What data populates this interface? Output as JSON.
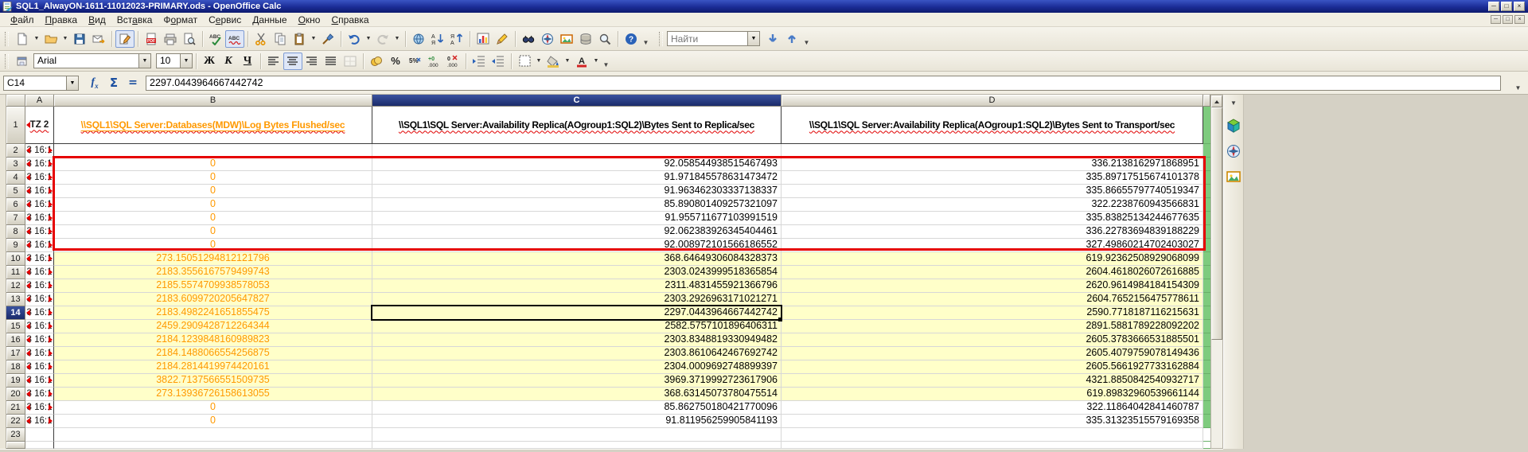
{
  "window": {
    "title": "SQL1_AlwayON-1611-11012023-PRIMARY.ods - OpenOffice Calc",
    "controls": {
      "minimize": "─",
      "maximize": "□",
      "close": "×"
    }
  },
  "menu": {
    "items": [
      {
        "label": "Файл",
        "accel": 0
      },
      {
        "label": "Правка",
        "accel": 0
      },
      {
        "label": "Вид",
        "accel": 0
      },
      {
        "label": "Вставка",
        "accel": 3
      },
      {
        "label": "Формат",
        "accel": 1
      },
      {
        "label": "Сервис",
        "accel": 1
      },
      {
        "label": "Данные",
        "accel": 0
      },
      {
        "label": "Окно",
        "accel": 0
      },
      {
        "label": "Справка",
        "accel": 0
      }
    ]
  },
  "standard_toolbar": {
    "find": {
      "placeholder": "Найти"
    }
  },
  "formatting_toolbar": {
    "font_name": "Arial",
    "font_size": "10",
    "bold_label": "Ж",
    "italic_label": "К",
    "underline_label": "Ч"
  },
  "formula_bar": {
    "cell_reference": "C14",
    "content": "2297.0443964667442742"
  },
  "icons": {
    "standard_toolbar": [
      "new-document",
      "open",
      "save",
      "send-email",
      "edit-file",
      "export-pdf",
      "print",
      "page-preview",
      "spellcheck",
      "auto-spellcheck",
      "cut",
      "copy",
      "paste",
      "format-paintbrush",
      "undo",
      "redo",
      "hyperlink",
      "sort-ascending",
      "sort-descending",
      "insert-chart",
      "draw-functions",
      "find-replace",
      "navigator",
      "gallery",
      "data-sources",
      "zoom",
      "help",
      "find-next",
      "find-previous"
    ],
    "formatting_toolbar": [
      "styles",
      "bold",
      "italic",
      "underline",
      "align-left",
      "align-center",
      "align-right",
      "align-justify",
      "merge-cells",
      "currency",
      "percent",
      "standard-format",
      "add-decimal",
      "delete-decimal",
      "decrease-indent",
      "increase-indent",
      "borders",
      "background-color",
      "font-color"
    ],
    "side_toolbar": [
      "cube",
      "navigator-compass",
      "gallery"
    ]
  },
  "sheet": {
    "active_cell": {
      "column": "C",
      "row": 14
    },
    "column_headers": [
      "A",
      "B",
      "C",
      "D"
    ],
    "header_row": {
      "a": "TZ 2",
      "b": "\\\\SQL1\\SQL Server:Databases(MDW)\\Log Bytes Flushed/sec",
      "c": "\\\\SQL1\\SQL Server:Availability Replica(AOgroup1:SQL2)\\Bytes Sent to Replica/sec",
      "d": "\\\\SQL1\\SQL Server:Availability Replica(AOgroup1:SQL2)\\Bytes Sent to Transport/sec"
    },
    "timestamp_cell_text": "3 16:1",
    "highlight": {
      "red_box_rows": [
        3,
        9
      ],
      "yellow_rows": [
        10,
        20
      ]
    },
    "rows": [
      {
        "n": 2,
        "b": "",
        "c": "",
        "d": ""
      },
      {
        "n": 3,
        "b": "0",
        "c": "92.058544938515467493",
        "d": "336.2138162971868951"
      },
      {
        "n": 4,
        "b": "0",
        "c": "91.971845578631473472",
        "d": "335.89717515674101378"
      },
      {
        "n": 5,
        "b": "0",
        "c": "91.963462303337138337",
        "d": "335.86655797740519347"
      },
      {
        "n": 6,
        "b": "0",
        "c": "85.890801409257321097",
        "d": "322.2238760943566831"
      },
      {
        "n": 7,
        "b": "0",
        "c": "91.955711677103991519",
        "d": "335.83825134244677635"
      },
      {
        "n": 8,
        "b": "0",
        "c": "92.062383926345404461",
        "d": "336.22783694839188229"
      },
      {
        "n": 9,
        "b": "0",
        "c": "92.008972101566186552",
        "d": "327.49860214702403027"
      },
      {
        "n": 10,
        "b": "273.15051294812121796",
        "c": "368.64649306084328373",
        "d": "619.92362508929068099"
      },
      {
        "n": 11,
        "b": "2183.3556167579499743",
        "c": "2303.0243999518365854",
        "d": "2604.4618026072616885"
      },
      {
        "n": 12,
        "b": "2185.5574709938578053",
        "c": "2311.4831455921366796",
        "d": "2620.9614984184154309"
      },
      {
        "n": 13,
        "b": "2183.6099720205647827",
        "c": "2303.2926963171021271",
        "d": "2604.7652156475778611"
      },
      {
        "n": 14,
        "b": "2183.4982241651855475",
        "c": "2297.0443964667442742",
        "d": "2590.7718187116215631"
      },
      {
        "n": 15,
        "b": "2459.2909428712264344",
        "c": "2582.5757101896406311",
        "d": "2891.5881789228092202"
      },
      {
        "n": 16,
        "b": "2184.1239848160989823",
        "c": "2303.8348819330949482",
        "d": "2605.3783666531885501"
      },
      {
        "n": 17,
        "b": "2184.1488066554256875",
        "c": "2303.8610642467692742",
        "d": "2605.4079759078149436"
      },
      {
        "n": 18,
        "b": "2184.2814419974420161",
        "c": "2304.0009692748899397",
        "d": "2605.5661927733162884"
      },
      {
        "n": 19,
        "b": "3822.7137566551509735",
        "c": "3969.3719992723617906",
        "d": "4321.8850842540932717"
      },
      {
        "n": 20,
        "b": "273.13936726158613055",
        "c": "368.63145073780475514",
        "d": "619.89832960539661144"
      },
      {
        "n": 21,
        "b": "0",
        "c": "85.862750180421770096",
        "d": "322.11864042841460787"
      },
      {
        "n": 22,
        "b": "0",
        "c": "91.811956259905841193",
        "d": "335.31323515579169358"
      },
      {
        "n": 23,
        "b": "",
        "c": "",
        "d": ""
      }
    ]
  },
  "colors": {
    "orange_text": "#ff9900",
    "yellow_fill": "#ffffc9",
    "red_box": "#e60000",
    "green_column": "#7ecb7e",
    "active_header": "#1b2b6a"
  }
}
